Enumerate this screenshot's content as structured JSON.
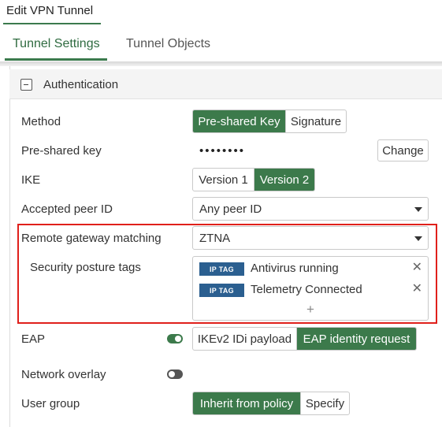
{
  "window": {
    "title": "Edit VPN Tunnel"
  },
  "tabs": [
    {
      "label": "Tunnel Settings",
      "active": true
    },
    {
      "label": "Tunnel Objects",
      "active": false
    }
  ],
  "section": {
    "title": "Authentication",
    "icon": "collapse-minus-icon"
  },
  "method": {
    "label": "Method",
    "options": [
      "Pre-shared Key",
      "Signature"
    ],
    "selected": "Pre-shared Key"
  },
  "psk": {
    "label": "Pre-shared key",
    "masked_value": "••••••••",
    "change_label": "Change"
  },
  "ike": {
    "label": "IKE",
    "options": [
      "Version 1",
      "Version 2"
    ],
    "selected": "Version 2"
  },
  "peer_id": {
    "label": "Accepted peer ID",
    "value": "Any peer ID"
  },
  "remote_gw": {
    "label": "Remote gateway matching",
    "value": "ZTNA"
  },
  "posture": {
    "label": "Security posture tags",
    "tags": [
      {
        "badge": "IP TAG",
        "text": "Antivirus running"
      },
      {
        "badge": "IP TAG",
        "text": "Telemetry Connected"
      }
    ],
    "add_symbol": "+",
    "remove_symbol": "✕"
  },
  "eap": {
    "label": "EAP",
    "enabled": true,
    "options": [
      "IKEv2 IDi payload",
      "EAP identity request"
    ],
    "selected": "EAP identity request"
  },
  "network_overlay": {
    "label": "Network overlay",
    "enabled": false
  },
  "user_group": {
    "label": "User group",
    "options": [
      "Inherit from policy",
      "Specify"
    ],
    "selected": "Inherit from policy"
  },
  "colors": {
    "accent": "#3c7a4b",
    "tag": "#2b5f90",
    "highlight": "#e0201b"
  }
}
